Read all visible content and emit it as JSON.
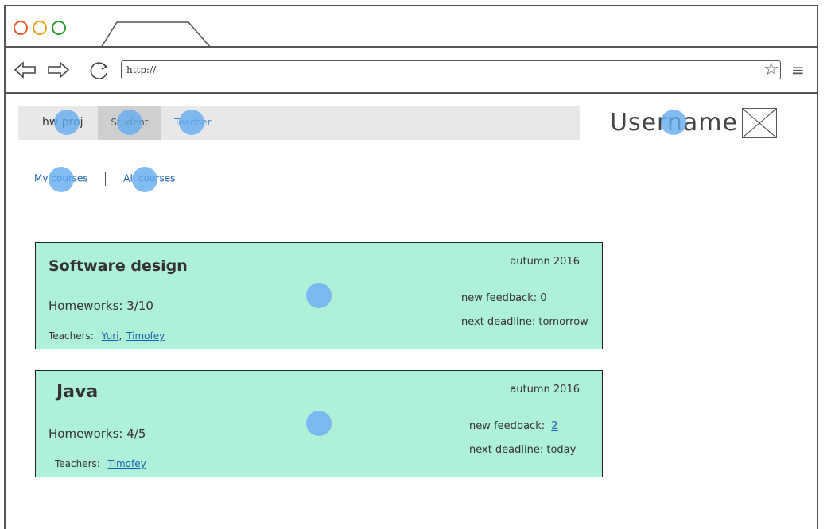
{
  "browser": {
    "url": "http://",
    "dots": [
      "#e05a2b",
      "#e6a21b",
      "#2a9d2a"
    ]
  },
  "nav": {
    "brand": "hw proj",
    "student": "Student",
    "teacher": "Teacher"
  },
  "user": {
    "username": "Username"
  },
  "links": {
    "my_courses": "My courses",
    "all_courses": "All courses"
  },
  "courses": [
    {
      "title": "Software design",
      "semester": "autumn 2016",
      "homeworks": "Homeworks: 3/10",
      "teachers_label": "Teachers:",
      "teachers": [
        "Yuri",
        "Timofey"
      ],
      "feedback_label": "new feedback:",
      "feedback_value": "0",
      "deadline": "next deadline: tomorrow"
    },
    {
      "title": "Java",
      "semester": "autumn 2016",
      "homeworks": "Homeworks: 4/5",
      "teachers_label": "Teachers:",
      "teachers": [
        "Timofey"
      ],
      "feedback_label": "new feedback:",
      "feedback_value": "2",
      "deadline": "next deadline: today"
    }
  ]
}
